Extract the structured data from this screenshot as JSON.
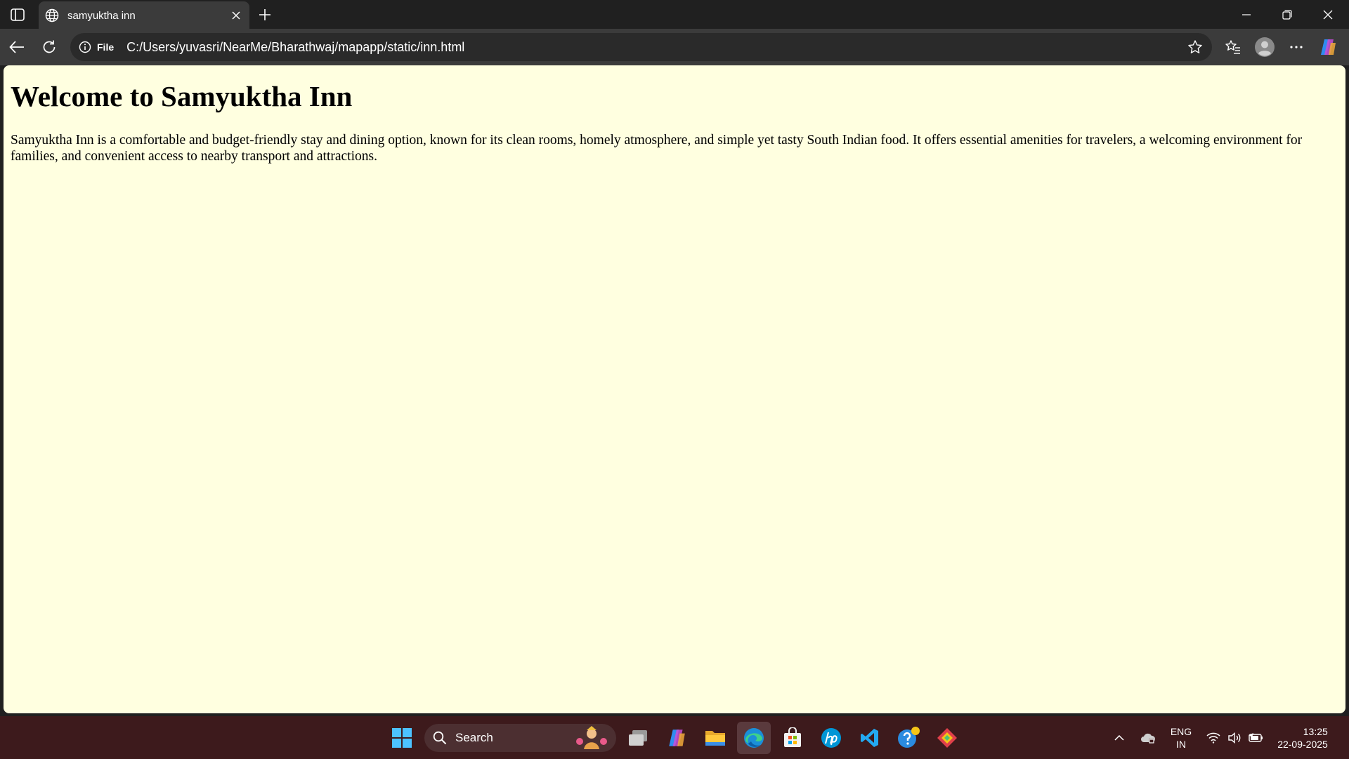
{
  "browser": {
    "tab_title": "samyuktha inn",
    "address_scheme": "File",
    "address_url": "C:/Users/yuvasri/NearMe/Bharathwaj/mapapp/static/inn.html"
  },
  "page": {
    "heading": "Welcome to Samyuktha Inn",
    "paragraph": "Samyuktha Inn is a comfortable and budget-friendly stay and dining option, known for its clean rooms, homely atmosphere, and simple yet tasty South Indian food. It offers essential amenities for travelers, a welcoming environment for families, and convenient access to nearby transport and attractions.",
    "background": "#ffffe0"
  },
  "taskbar": {
    "search_label": "Search",
    "lang_top": "ENG",
    "lang_bottom": "IN",
    "time": "13:25",
    "date": "22-09-2025"
  },
  "colors": {
    "chrome": "#202020",
    "toolbar": "#3b3b3b",
    "taskbar": "#3d1a1c"
  }
}
